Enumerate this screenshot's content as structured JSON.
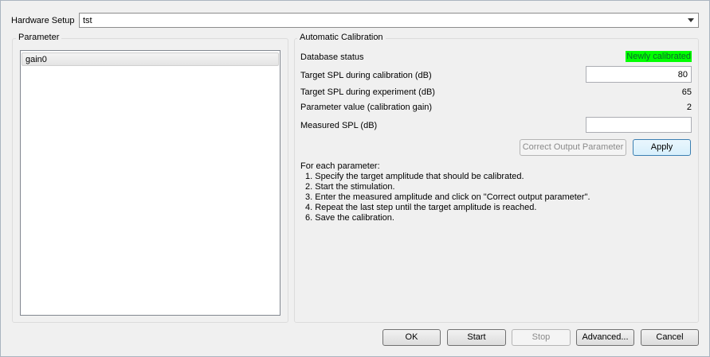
{
  "hardware_setup": {
    "label": "Hardware Setup",
    "selected": "tst"
  },
  "parameter_group": {
    "title": "Parameter",
    "items": [
      {
        "label": "gain0"
      }
    ]
  },
  "calibration": {
    "title": "Automatic Calibration",
    "database_status_label": "Database status",
    "database_status_value": "Newly calibrated",
    "status_color": "#00ff00",
    "target_spl_calibration_label": "Target SPL during calibration (dB)",
    "target_spl_calibration_value": "80",
    "target_spl_experiment_label": "Target SPL during experiment (dB)",
    "target_spl_experiment_value": "65",
    "parameter_value_label": "Parameter value (calibration gain)",
    "parameter_value": "2",
    "measured_spl_label": "Measured SPL (dB)",
    "measured_spl_value": "",
    "correct_button": "Correct Output Parameter",
    "apply_button": "Apply",
    "instructions": {
      "heading": "For each parameter:",
      "steps": [
        "1. Specify the target amplitude that should be calibrated.",
        "2. Start the stimulation.",
        "3. Enter the measured amplitude and click on \"Correct output parameter\".",
        "4. Repeat the last step until the target amplitude is reached.",
        "6. Save the calibration."
      ]
    }
  },
  "footer": {
    "ok": "OK",
    "start": "Start",
    "stop": "Stop",
    "advanced": "Advanced...",
    "cancel": "Cancel"
  }
}
